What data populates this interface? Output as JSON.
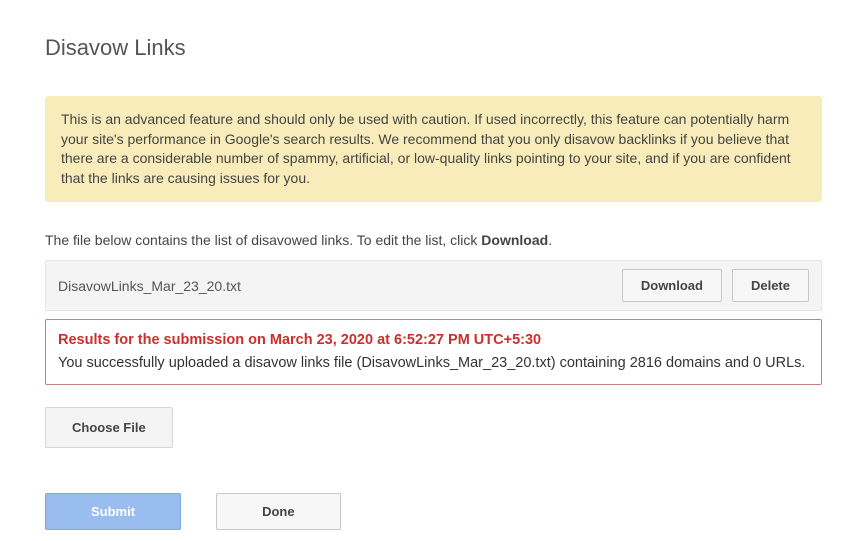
{
  "page_title": "Disavow Links",
  "warning_text": "This is an advanced feature and should only be used with caution. If used incorrectly, this feature can potentially harm your site's performance in Google's search results. We recommend that you only disavow backlinks if you believe that there are a considerable number of spammy, artificial, or low-quality links pointing to your site, and if you are confident that the links are causing issues for you.",
  "instruction_prefix": "The file below contains the list of disavowed links. To edit the list, click ",
  "instruction_action": "Download",
  "instruction_suffix": ".",
  "file": {
    "name": "DisavowLinks_Mar_23_20.txt",
    "download_label": "Download",
    "delete_label": "Delete"
  },
  "result": {
    "title": "Results for the submission on March 23, 2020 at 6:52:27 PM UTC+5:30",
    "body": "You successfully uploaded a disavow links file (DisavowLinks_Mar_23_20.txt) containing 2816 domains and 0 URLs."
  },
  "choose_file_label": "Choose File",
  "submit_label": "Submit",
  "done_label": "Done"
}
